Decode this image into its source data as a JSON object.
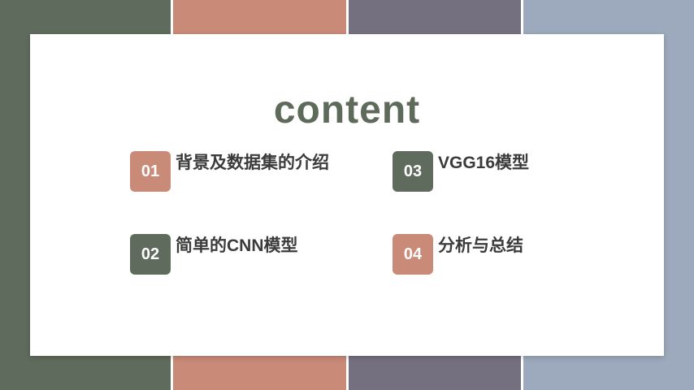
{
  "colors": {
    "stripe_1": "#5f6b5c",
    "stripe_2": "#c98a78",
    "stripe_3": "#75707f",
    "stripe_4": "#9da9bc",
    "title": "#5e6b5b",
    "badge_green": "#5f6b5c",
    "badge_salmon": "#c98a78"
  },
  "slide": {
    "title": "content"
  },
  "items": [
    {
      "number": "01",
      "label": "背景及数据集的介绍",
      "badge_color": "#c98a78"
    },
    {
      "number": "02",
      "label": "简单的CNN模型",
      "badge_color": "#5f6b5c"
    },
    {
      "number": "03",
      "label": "VGG16模型",
      "badge_color": "#5f6b5c"
    },
    {
      "number": "04",
      "label": "分析与总结",
      "badge_color": "#c98a78"
    }
  ]
}
